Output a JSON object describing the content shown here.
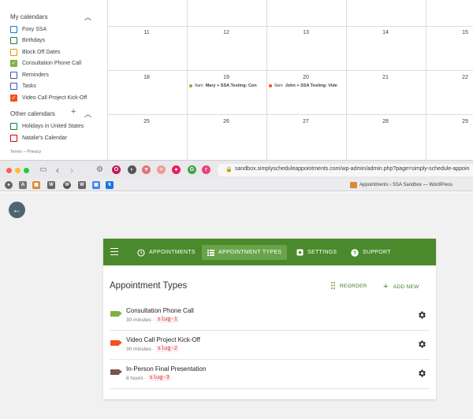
{
  "gcal": {
    "my_calendars_label": "My calendars",
    "my_calendars": [
      {
        "label": "Foxy SSA",
        "color": "#1a73e8",
        "checked": false
      },
      {
        "label": "Birthdays",
        "color": "#0b8043",
        "checked": false
      },
      {
        "label": "Block Off Dates",
        "color": "#f09300",
        "checked": false
      },
      {
        "label": "Consultation Phone Call",
        "color": "#7cb342",
        "checked": true
      },
      {
        "label": "Reminders",
        "color": "#3f51b5",
        "checked": false
      },
      {
        "label": "Tasks",
        "color": "#3f51b5",
        "checked": false
      },
      {
        "label": "Video Call Project Kick-Off",
        "color": "#f4511e",
        "checked": true
      }
    ],
    "other_calendars_label": "Other calendars",
    "other_calendars": [
      {
        "label": "Holidays in United States",
        "color": "#0b8043",
        "checked": false
      },
      {
        "label": "Natalie's Calendar",
        "color": "#d50000",
        "checked": false
      }
    ],
    "terms_text": "Terms – Privacy",
    "week1_days": [
      "11",
      "12",
      "13",
      "14",
      "15"
    ],
    "week2_days": [
      "18",
      "19",
      "20",
      "21",
      "22"
    ],
    "week3_days": [
      "25",
      "26",
      "27",
      "28",
      "29"
    ],
    "events": [
      {
        "time": "9am",
        "title": "Mary + SSA Testing: Con",
        "color": "#7cb342"
      },
      {
        "time": "9am",
        "title": "John + SSA Testing: Vide",
        "color": "#f4511e"
      }
    ]
  },
  "browser": {
    "url": "sandbox.simplyscheduleappointments.com/wp-admin/admin.php?page=simply-schedule-appoin",
    "tab_title": "Appointments ‹ SSA Sandbox — WordPress"
  },
  "ssa": {
    "nav": {
      "appointments": "APPOINTMENTS",
      "appointment_types": "APPOINTMENT TYPES",
      "settings": "SETTINGS",
      "support": "SUPPORT"
    },
    "title": "Appointment Types",
    "reorder_label": "REORDER",
    "add_new_label": "ADD NEW",
    "types": [
      {
        "name": "Consultation Phone Call",
        "duration": "30 minutes ·",
        "slug": "slug-1",
        "color": "#7cb342"
      },
      {
        "name": "Video Call Project Kick-Off",
        "duration": "30 minutes ·",
        "slug": "slug-2",
        "color": "#f4511e"
      },
      {
        "name": "In-Person Final Presentation",
        "duration": "8 hours ·",
        "slug": "slug-3",
        "color": "#795548"
      }
    ]
  },
  "colors": {
    "brand_green": "#4b8a2c",
    "active_tab": "#69a34a",
    "back_button": "#4f6670"
  }
}
